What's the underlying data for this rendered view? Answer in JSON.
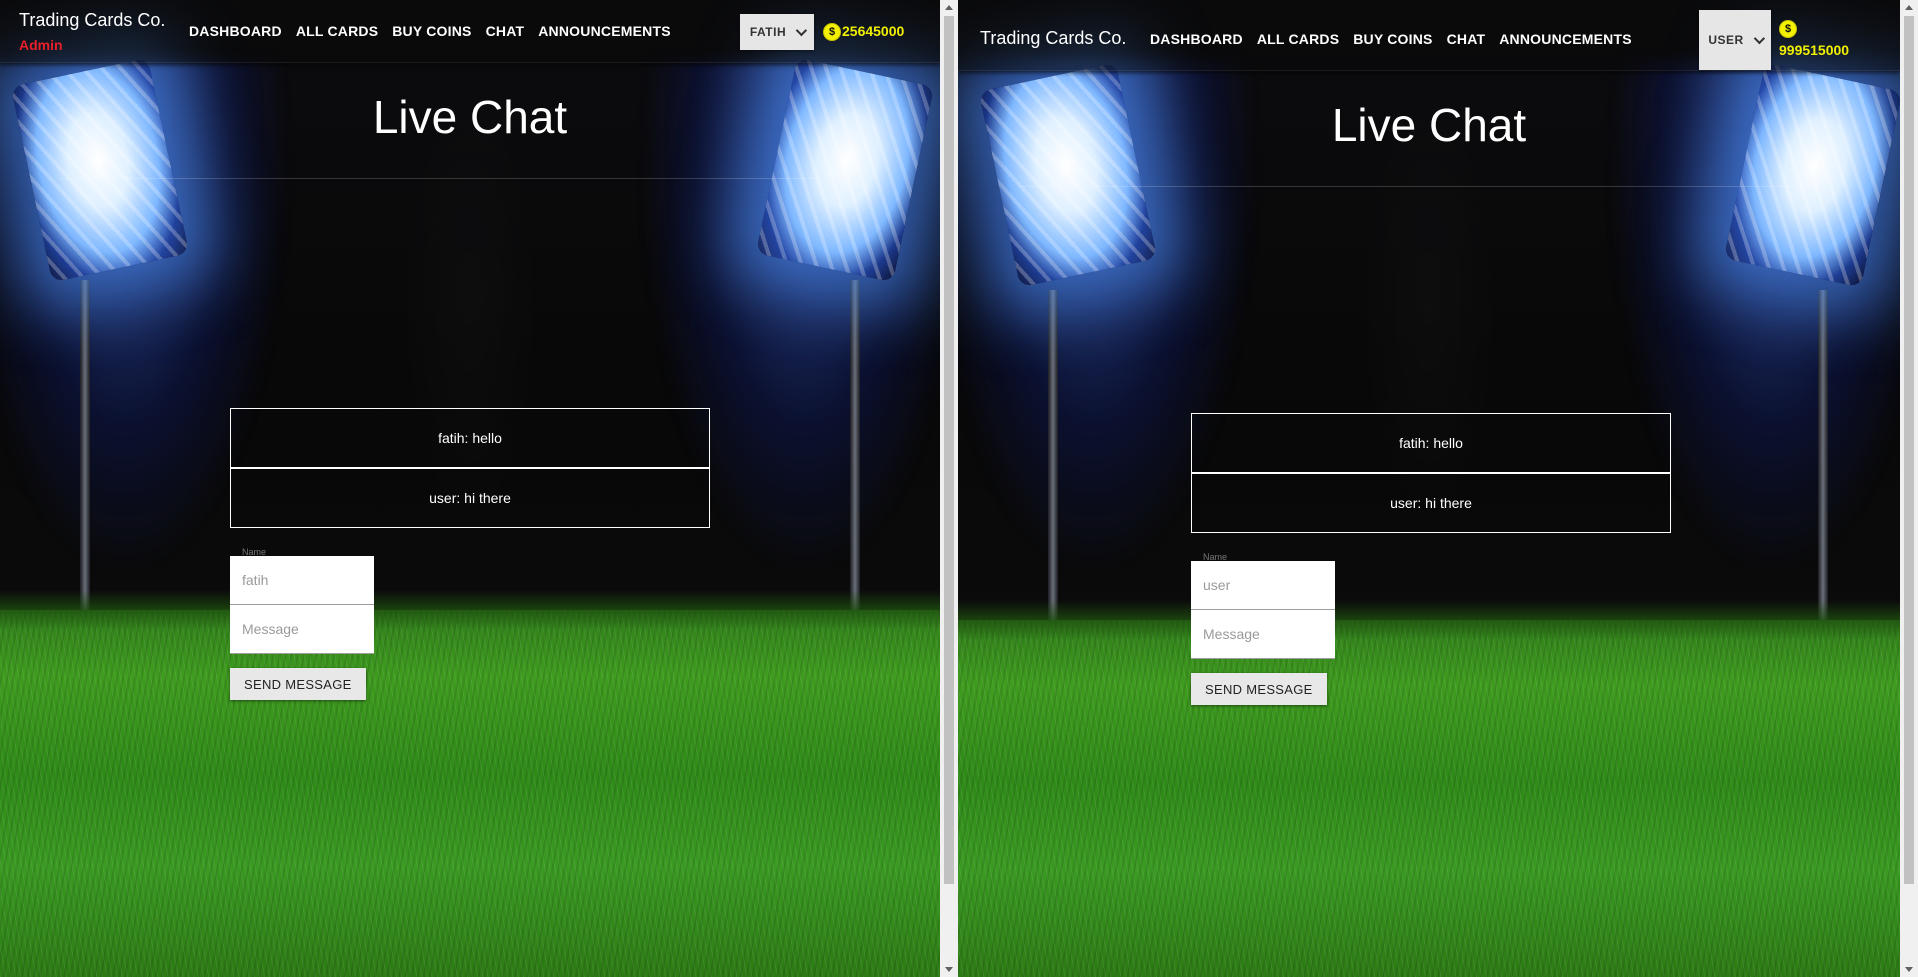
{
  "left": {
    "brand": "Trading Cards Co.",
    "role": "Admin",
    "nav": [
      "DASHBOARD",
      "ALL CARDS",
      "BUY COINS",
      "CHAT",
      "ANNOUNCEMENTS"
    ],
    "user_button": "FATIH",
    "coins": "25645000",
    "page_title": "Live Chat",
    "messages": [
      "fatih: hello",
      "user: hi there"
    ],
    "name_label": "Name",
    "name_value": "fatih",
    "message_placeholder": "Message",
    "send_label": "SEND MESSAGE"
  },
  "right": {
    "brand": "Trading Cards Co.",
    "nav": [
      "DASHBOARD",
      "ALL CARDS",
      "BUY COINS",
      "CHAT",
      "ANNOUNCEMENTS"
    ],
    "user_button": "USER",
    "coins": "999515000",
    "page_title": "Live Chat",
    "messages": [
      "fatih: hello",
      "user: hi there"
    ],
    "name_label": "Name",
    "name_value": "user",
    "message_placeholder": "Message",
    "send_label": "SEND MESSAGE"
  },
  "colors": {
    "coin_yellow": "#f0f000",
    "admin_red": "#e8202a",
    "grass_green": "#3f9c1f"
  },
  "icons": {
    "coin": "dollar-coin-icon",
    "dropdown": "chevron-down-icon"
  }
}
